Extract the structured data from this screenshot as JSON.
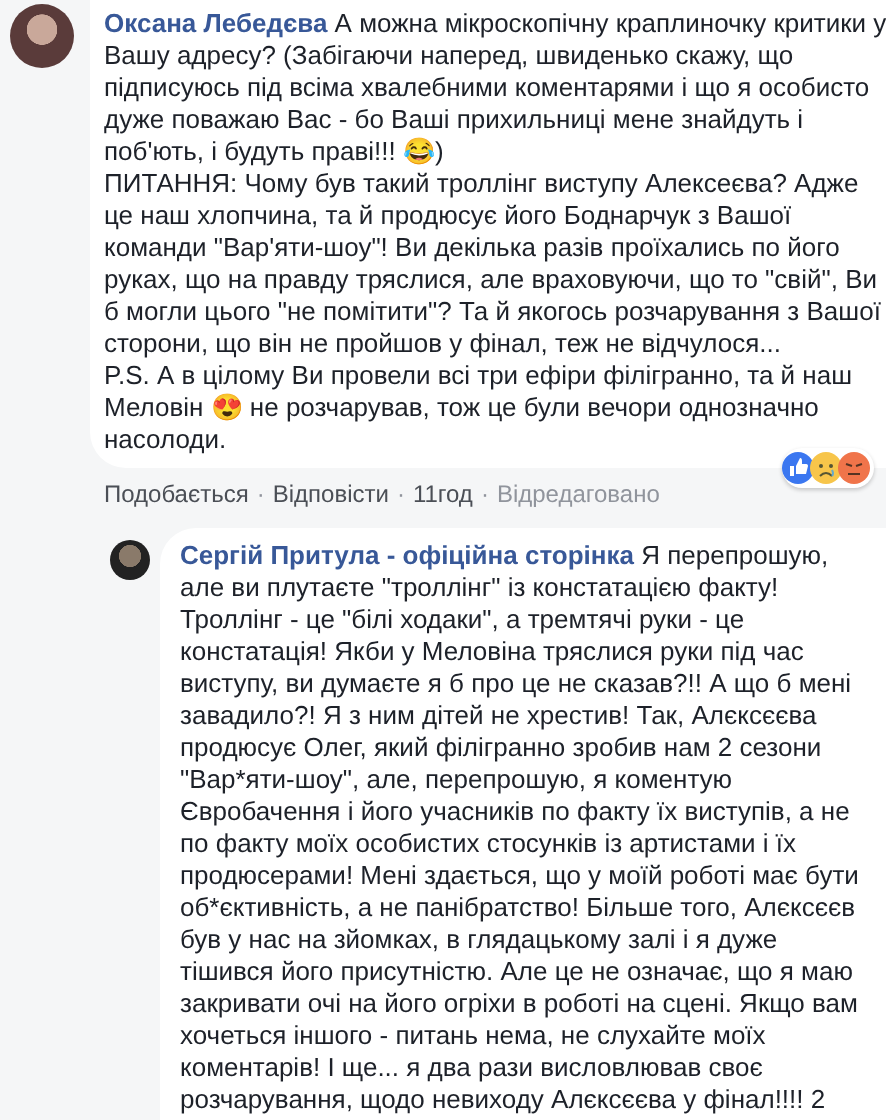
{
  "comments": [
    {
      "author": "Оксана Лебедєва",
      "text": " А можна мікроскопічну краплиночку критики у\nВашу адресу? (Забігаючи наперед, швиденько скажу, що\nпідписуюсь під всіма хвалебними коментарями і що я особисто\nдуже поважаю Вас - бо Ваші прихильниці мене знайдуть і\nпоб'ють, і будуть праві!!! 😂)\nПИТАННЯ: Чому був такий троллінг виступу Алексеєва? Адже\nце наш хлопчина, та й продюсує його Боднарчук з Вашої\nкоманди \"Вар'яти-шоу\"! Ви декілька разів проїхались по його\nруках, що на правду тряслися, але враховуючи, що то \"свій\", Ви\nб могли цього \"не помітити\"? Та й якогось розчарування з Вашої\nсторони, що він не пройшов у фінал, теж не відчулося...\nP.S. А в цілому Ви провели всі три ефіри філігранно, та й наш\nМеловін 😍 не розчарував, тож це були вечори однозначно\nнасолоди.",
      "actions": [
        {
          "kind": "link",
          "label": "Подобається"
        },
        {
          "kind": "separator",
          "label": "·"
        },
        {
          "kind": "link",
          "label": "Відповісти"
        },
        {
          "kind": "separator",
          "label": "·"
        },
        {
          "kind": "time",
          "label": "11год"
        },
        {
          "kind": "separator",
          "label": "·"
        },
        {
          "kind": "note",
          "label": "Відредаговано"
        }
      ],
      "reactions": [
        {
          "kind": "like"
        },
        {
          "kind": "sad"
        },
        {
          "kind": "angry"
        }
      ],
      "reply": false
    },
    {
      "author": "Сергій Притула - офіційна сторінка",
      "text": " Я перепрошую,\nале ви плутаєте \"троллінг\" із констатацією факту!\nТроллінг - це \"білі ходаки\", а тремтячі руки - це\nконстатація! Якби у Меловіна тряслися руки під час\nвиступу, ви думаєте я б про це не сказав?!! А що б мені\nзавадило?! Я з ним дітей не хрестив! Так, Алєксєєва\nпродюсує Олег, який філігранно зробив нам 2 сезони\n\"Вар*яти-шоу\", але, перепрошую, я коментую\nЄвробачення і його учасників по факту їх виступів, а не\nпо факту моїх особистих стосунків із артистами і їх\nпродюсерами! Мені здається, що у моїй роботі має бути\nоб*єктивність, а не панібратство! Більше того, Алєксєєв\nбув у нас на зйомках, в глядацькому залі і я дуже\nтішився його присутністю. Але це не означає, що я маю\nзакривати очі на його огріхи в роботі на сцені. Якщо вам\nхочеться іншого - питань нема, не слухайте моїх\nкоментарів! І ще... я два рази висловлював своє\nрозчарування, щодо невиходу Алєксєєва у фінал!!!! 2",
      "reply": true
    }
  ]
}
